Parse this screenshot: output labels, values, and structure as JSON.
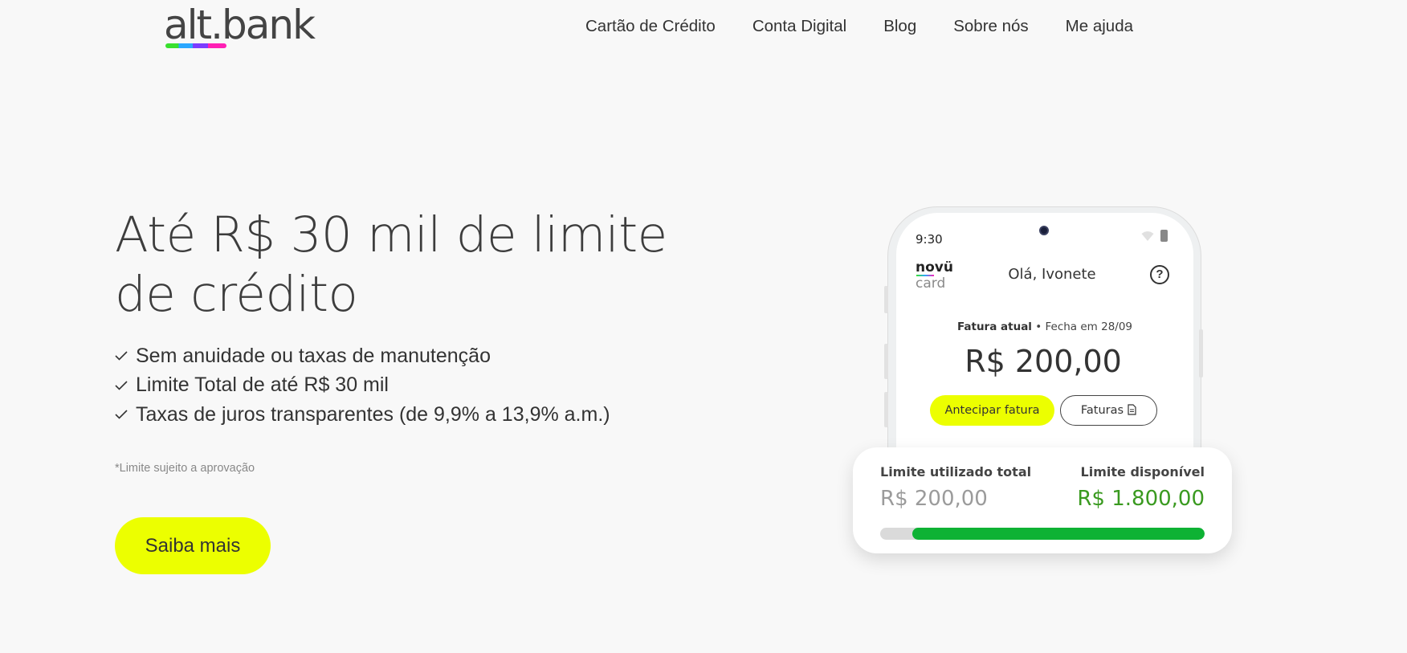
{
  "header": {
    "logo_text": "alt.bank",
    "nav": [
      {
        "label": "Cartão de Crédito"
      },
      {
        "label": "Conta Digital"
      },
      {
        "label": "Blog"
      },
      {
        "label": "Sobre nós"
      },
      {
        "label": "Me ajuda"
      }
    ]
  },
  "hero": {
    "title": "Até R$ 30 mil de limite de crédito",
    "benefits": [
      "Sem anuidade ou taxas de manutenção",
      "Limite Total de até R$ 30 mil",
      "Taxas de juros transparentes (de 9,9% a 13,9% a.m.)"
    ],
    "disclaimer": "*Limite sujeito a aprovação",
    "cta_label": "Saiba mais"
  },
  "phone": {
    "status_time": "9:30",
    "brand_top": "novü",
    "brand_bottom": "card",
    "greeting": "Olá, Ivonete",
    "help_icon": "?",
    "invoice_label": "Fatura atual",
    "invoice_close": "• Fecha em 28/09",
    "invoice_amount": "R$ 200,00",
    "antecipar_label": "Antecipar fatura",
    "faturas_label": "Faturas"
  },
  "limit_card": {
    "used_label": "Limite utilizado total",
    "used_value": "R$ 200,00",
    "available_label": "Limite disponível",
    "available_value": "R$ 1.800,00",
    "available_fraction": 0.9
  },
  "colors": {
    "accent_yellow": "#ecff00",
    "available_green": "#3a9a20",
    "bar_green": "#0eb234",
    "background": "#f8f8f8"
  }
}
